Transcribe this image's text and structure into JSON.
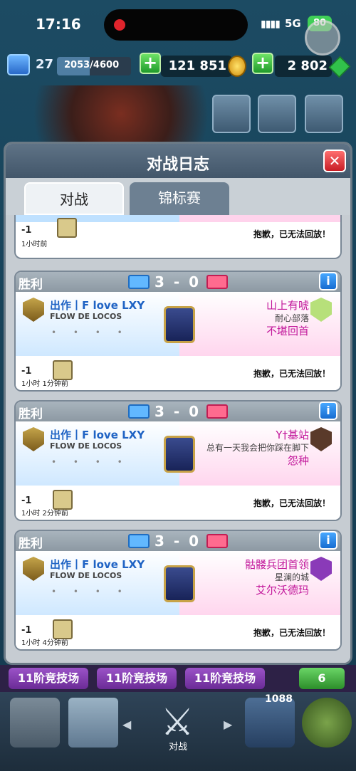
{
  "status": {
    "time": "17:16",
    "signal": "▮▮▮▮",
    "network": "5G",
    "battery": "80"
  },
  "resources": {
    "level": "27",
    "xp": "2053/4600",
    "xp_fraction": 0.446,
    "gold": "121 851",
    "gems": "2 802"
  },
  "modal": {
    "title": "对战日志",
    "close_label": "✕",
    "tabs": [
      {
        "label": "对战",
        "active": true
      },
      {
        "label": "锦标赛",
        "active": false
      }
    ]
  },
  "partial_entry": {
    "trophy": "-1",
    "time_ago": "1小时前",
    "replay_note": "抱歉，已无法回放！"
  },
  "battles": [
    {
      "result": "胜利",
      "score": "3 - 0",
      "left": {
        "name": "出作丨F love LXY",
        "clan": "FLOW DE LOCOS",
        "dots": "• • • •"
      },
      "right": {
        "name": "山上有唬",
        "clan": "耐心部落",
        "name2": "不堪回首"
      },
      "trophy": "-1",
      "time_ago": "1小时 1分钟前",
      "replay_note": "抱歉，已无法回放！",
      "right_badge_color": "#b7e07a"
    },
    {
      "result": "胜利",
      "score": "3 - 0",
      "left": {
        "name": "出作丨F love LXY",
        "clan": "FLOW DE LOCOS",
        "dots": "• • • •"
      },
      "right": {
        "name": "Y†基站",
        "clan": "总有一天我会把你踩在脚下",
        "name2": "怨种"
      },
      "trophy": "-1",
      "time_ago": "1小时 2分钟前",
      "replay_note": "抱歉，已无法回放！",
      "right_badge_color": "#5a3a2a"
    },
    {
      "result": "胜利",
      "score": "3 - 0",
      "left": {
        "name": "出作丨F love LXY",
        "clan": "FLOW DE LOCOS",
        "dots": "• • • •"
      },
      "right": {
        "name": "骷髅兵团首领",
        "clan": "星澜的城",
        "name2": "艾尔沃德玛"
      },
      "trophy": "-1",
      "time_ago": "1小时 4分钟前",
      "replay_note": "抱歉，已无法回放！",
      "right_badge_color": "#8a3ab8"
    }
  ],
  "league_strip": [
    "11阶竞技场",
    "11阶竞技场",
    "11阶竞技场",
    "6"
  ],
  "nav": {
    "active_label": "对战",
    "badge": "1088"
  }
}
